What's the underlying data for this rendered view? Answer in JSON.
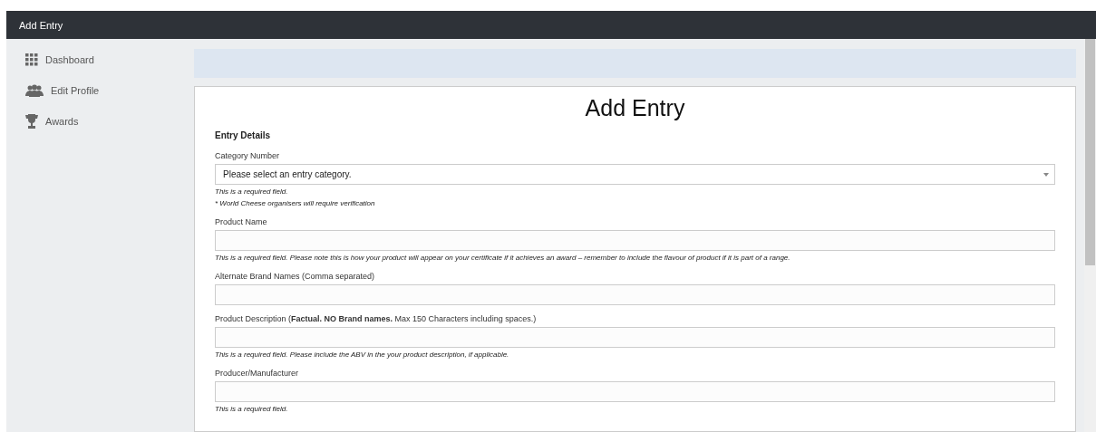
{
  "header": {
    "title": "Add Entry"
  },
  "sidebar": {
    "items": [
      {
        "label": "Dashboard",
        "kind": "grid"
      },
      {
        "label": "Edit Profile",
        "kind": "people"
      },
      {
        "label": "Awards",
        "kind": "trophy"
      }
    ]
  },
  "form": {
    "title": "Add Entry",
    "section": "Entry Details",
    "fields": [
      {
        "kind": "select",
        "label": "Category Number",
        "placeholder": "Please select an entry category.",
        "hints": [
          "This is a required field.",
          "* World Cheese organisers will require verification"
        ]
      },
      {
        "kind": "text",
        "label": "Product Name",
        "hints": [
          "This is a required field. Please note this is how your product will appear on your certificate if it achieves an award – remember to include the flavour of product if it is part of a range."
        ]
      },
      {
        "kind": "text",
        "label": "Alternate Brand Names (Comma separated)"
      },
      {
        "kind": "text",
        "label": "Product Description (**Factual. NO Brand names.** Max 150 Characters including spaces.)",
        "hints": [
          "This is a required field. Please include the ABV in the your product description, if applicable."
        ]
      },
      {
        "kind": "text",
        "label": "Producer/Manufacturer",
        "hints": [
          "This is a required field."
        ]
      }
    ]
  }
}
